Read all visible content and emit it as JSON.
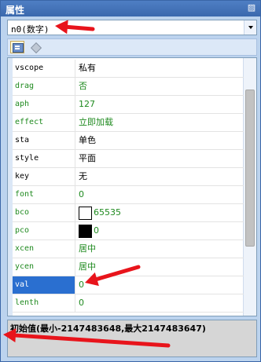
{
  "panel": {
    "title": "属性"
  },
  "object_select": {
    "value": "n0(数字)"
  },
  "icons": {
    "pin": "pin-icon",
    "sort": "categorized-icon",
    "diamond": "diamond-icon",
    "dropdown": "chevron-down-icon"
  },
  "properties": [
    {
      "name": "vscope",
      "value": "私有",
      "color": "black"
    },
    {
      "name": "drag",
      "value": "否",
      "color": "green"
    },
    {
      "name": "aph",
      "value": "127",
      "color": "green"
    },
    {
      "name": "effect",
      "value": "立即加载",
      "color": "green"
    },
    {
      "name": "sta",
      "value": "单色",
      "color": "black"
    },
    {
      "name": "style",
      "value": "平面",
      "color": "black"
    },
    {
      "name": "key",
      "value": "无",
      "color": "black"
    },
    {
      "name": "font",
      "value": "0",
      "color": "green"
    },
    {
      "name": "bco",
      "value": "65535",
      "color": "green",
      "swatch": "#ffffff"
    },
    {
      "name": "pco",
      "value": "0",
      "color": "green",
      "swatch": "#000000"
    },
    {
      "name": "xcen",
      "value": "居中",
      "color": "green"
    },
    {
      "name": "ycen",
      "value": "居中",
      "color": "green"
    },
    {
      "name": "val",
      "value": "0",
      "color": "green",
      "selected": true
    },
    {
      "name": "lenth",
      "value": "0",
      "color": "green"
    }
  ],
  "description": "初始值(最小-2147483648,最大2147483647)",
  "annotation_color": "#e8141b"
}
